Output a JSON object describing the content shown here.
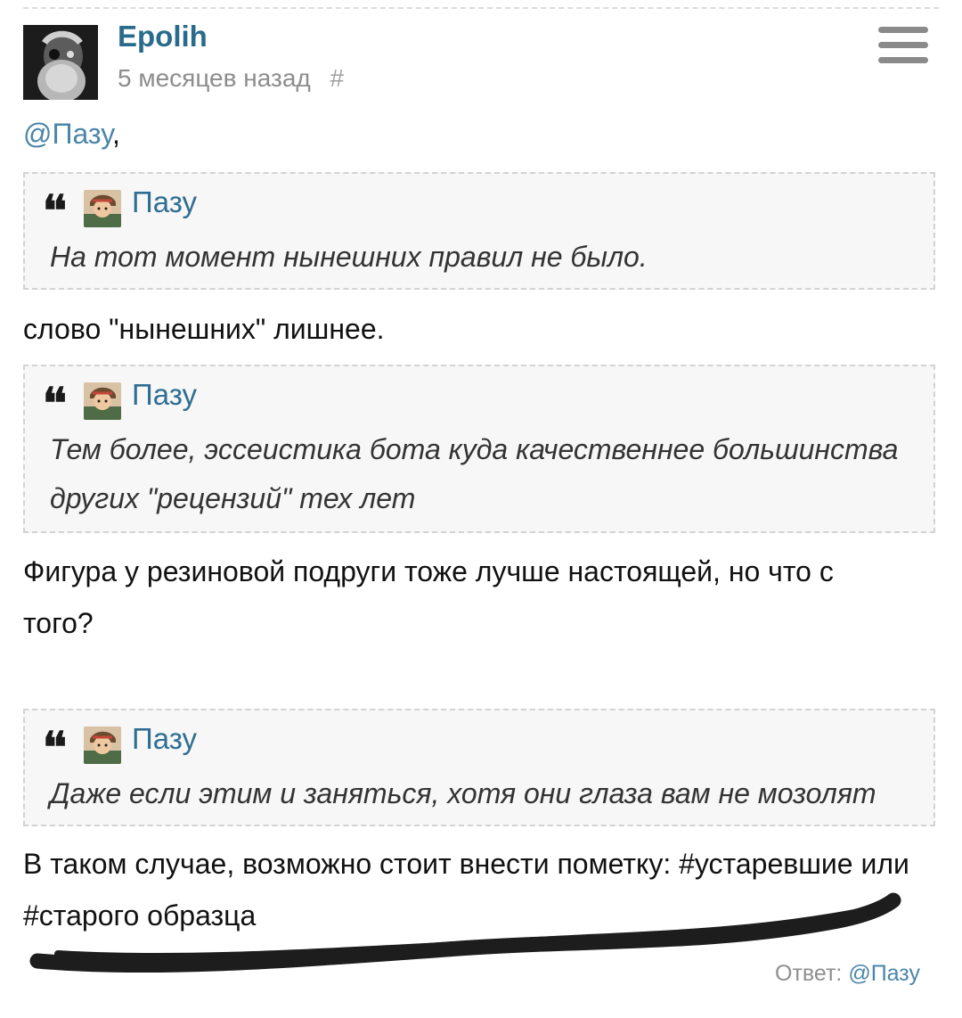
{
  "comment": {
    "author": "Epolih",
    "time_ago": "5 месяцев назад",
    "permalink_symbol": "#",
    "menu_icon": "hamburger-menu-icon",
    "mention": "@Пазу",
    "mention_suffix": ",",
    "quotes": [
      {
        "author": "Пазу",
        "text": "На тот момент нынешних правил не было."
      },
      {
        "author": "Пазу",
        "text": "Тем более, эссеистика бота куда качественнее большинства других \"рецензий\" тех лет"
      },
      {
        "author": "Пазу",
        "text": "Даже если этим и заняться, хотя они глаза вам не мозолят"
      }
    ],
    "paragraphs": [
      "слово \"нынешних\" лишнее.",
      "Фигура у резиновой подруги тоже лучше настоящей, но что с того?",
      "В таком случае, возможно стоит внести пометку: #устаревшие или #старого образца"
    ],
    "reply_label": "Ответ:",
    "reply_to": "@Пазу"
  },
  "colors": {
    "username": "#2a6b8c",
    "link": "#4b86a8",
    "quote_background": "#f7f7f7",
    "quote_border": "#d3d3d3",
    "muted_text": "#8d8d8d"
  }
}
